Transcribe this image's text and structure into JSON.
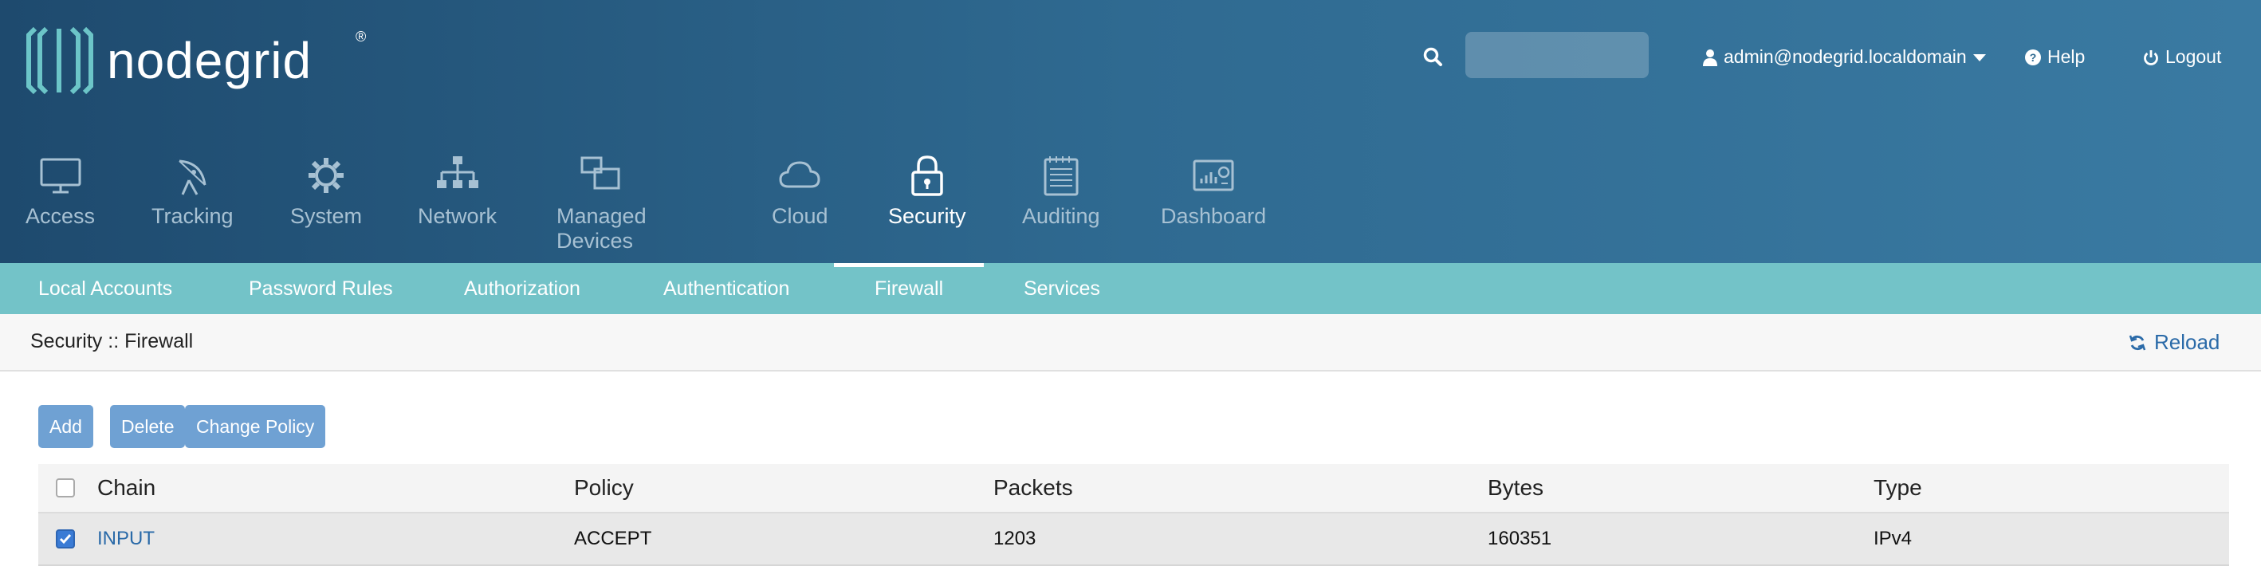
{
  "brand": {
    "name": "nodegrid",
    "reg": "®"
  },
  "header": {
    "search": {
      "placeholder": ""
    },
    "user": {
      "label": "admin@nodegrid.localdomain"
    },
    "help": {
      "label": "Help"
    },
    "logout": {
      "label": "Logout"
    }
  },
  "nav": [
    {
      "label": "Access",
      "icon": "monitor-icon",
      "active": false
    },
    {
      "label": "Tracking",
      "icon": "satellite-dish-icon",
      "active": false
    },
    {
      "label": "System",
      "icon": "gear-icon",
      "active": false
    },
    {
      "label": "Network",
      "icon": "network-icon",
      "active": false
    },
    {
      "label": "Managed Devices",
      "icon": "devices-icon",
      "active": false
    },
    {
      "label": "Cloud",
      "icon": "cloud-icon",
      "active": false
    },
    {
      "label": "Security",
      "icon": "lock-icon",
      "active": true
    },
    {
      "label": "Auditing",
      "icon": "notepad-icon",
      "active": false
    },
    {
      "label": "Dashboard",
      "icon": "dashboard-icon",
      "active": false
    }
  ],
  "subnav": [
    {
      "label": "Local Accounts"
    },
    {
      "label": "Password Rules"
    },
    {
      "label": "Authorization"
    },
    {
      "label": "Authentication"
    },
    {
      "label": "Firewall",
      "active": true
    },
    {
      "label": "Services"
    }
  ],
  "breadcrumb": "Security :: Firewall",
  "reload": {
    "label": "Reload"
  },
  "actions": {
    "add": "Add",
    "delete": "Delete",
    "change_policy": "Change Policy"
  },
  "table": {
    "headers": {
      "chain": "Chain",
      "policy": "Policy",
      "packets": "Packets",
      "bytes": "Bytes",
      "type": "Type"
    },
    "rows": [
      {
        "checked": true,
        "chain": "INPUT",
        "policy": "ACCEPT",
        "packets": "1203",
        "bytes": "160351",
        "type": "IPv4"
      }
    ]
  },
  "colors": {
    "header_start": "#1e4a6e",
    "header_end": "#3a7aa2",
    "subnav": "#73c3c8",
    "button": "#6fa1d3",
    "link": "#2a6aa8",
    "logo_accent": "#6cc5c8"
  }
}
